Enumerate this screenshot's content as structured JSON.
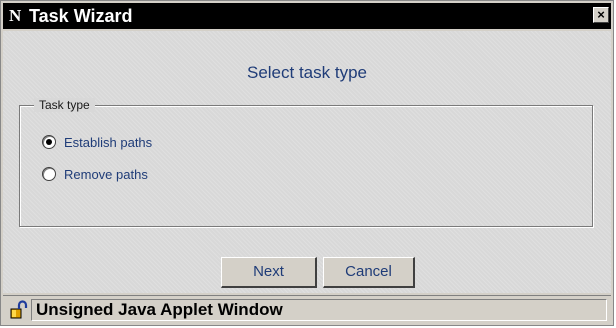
{
  "window": {
    "title": "Task Wizard",
    "app_icon": "N",
    "close_glyph": "×"
  },
  "content": {
    "heading": "Select task type",
    "group": {
      "legend": "Task type",
      "options": [
        {
          "label": "Establish paths",
          "checked": true
        },
        {
          "label": "Remove paths",
          "checked": false
        }
      ]
    }
  },
  "buttons": {
    "next_label": "Next",
    "cancel_label": "Cancel"
  },
  "status": {
    "text": "Unsigned Java Applet Window",
    "icon": "unlocked-padlock-icon"
  },
  "colors": {
    "titlebar": "#000000",
    "accent_text": "#1f3c78",
    "window_bg": "#d4d0c8"
  }
}
